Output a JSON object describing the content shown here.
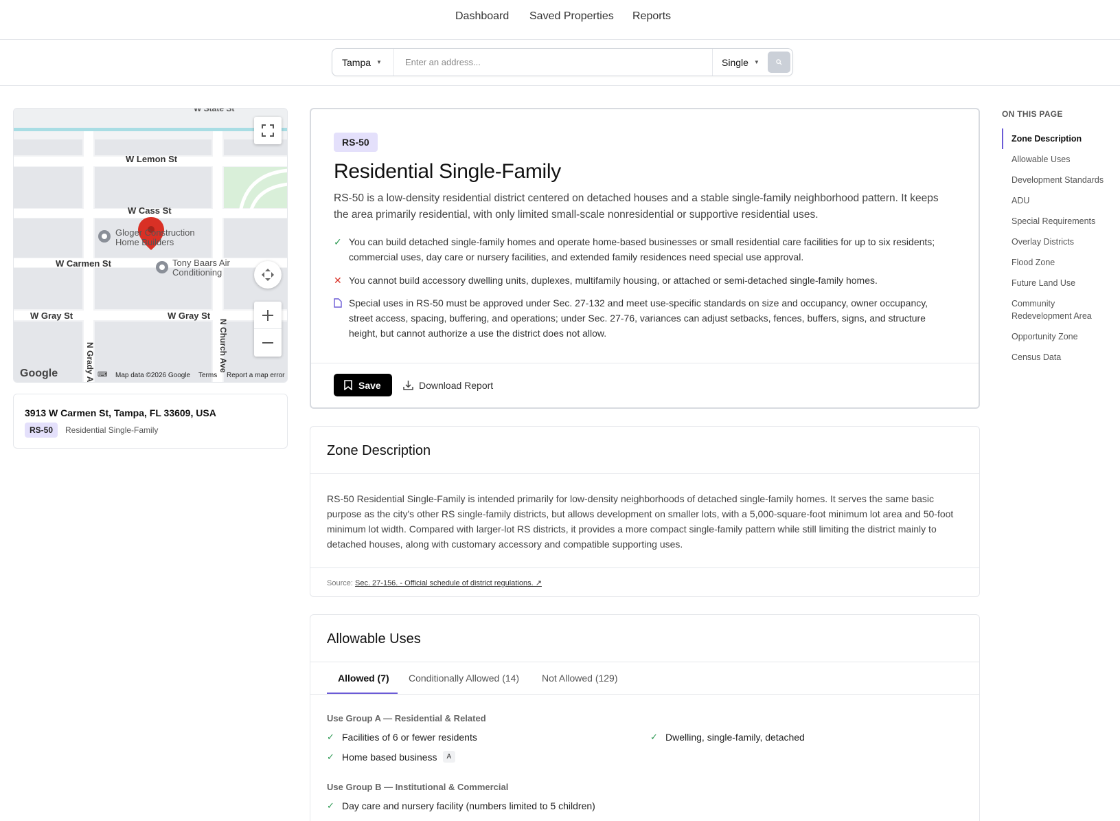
{
  "nav": {
    "links": [
      "Dashboard",
      "Saved Properties",
      "Reports"
    ]
  },
  "search": {
    "city": "Tampa",
    "address_placeholder": "Enter an address...",
    "type": "Single"
  },
  "map": {
    "streets": {
      "lemon": "W Lemon St",
      "cass": "W Cass St",
      "carmen": "W Carmen St",
      "gray_left": "W Gray St",
      "gray_right": "W Gray St",
      "grady": "N Grady A",
      "church": "N Church Ave",
      "state": "W State St"
    },
    "places": {
      "gloger_1": "Gloger Construction",
      "gloger_2": "Home Builders",
      "tony_1": "Tony Baars Air",
      "tony_2": "Conditioning"
    },
    "attribution": "Map data ©2026 Google",
    "terms": "Terms",
    "report": "Report a map error",
    "logo": "Google"
  },
  "property": {
    "address": "3913 W Carmen St, Tampa, FL 33609, USA",
    "zone_code": "RS-50",
    "zone_name": "Residential Single-Family"
  },
  "hero": {
    "zone_code": "RS-50",
    "title": "Residential Single-Family",
    "summary": "RS-50 is a low-density residential district centered on detached houses and a stable single-family neighborhood pattern. It keeps the area primarily residential, with only limited small-scale nonresidential or supportive residential uses.",
    "can": "You can build detached single-family homes and operate home-based businesses or small residential care facilities for up to six residents; commercial uses, day care or nursery facilities, and extended family residences need special use approval.",
    "cannot": "You cannot build accessory dwelling units, duplexes, multifamily housing, or attached or semi-detached single-family homes.",
    "special": "Special uses in RS-50 must be approved under Sec. 27-132 and meet use-specific standards on size and occupancy, owner occupancy, street access, spacing, buffering, and operations; under Sec. 27-76, variances can adjust setbacks, fences, buffers, signs, and structure height, but cannot authorize a use the district does not allow.",
    "save_label": "Save",
    "download_label": "Download Report"
  },
  "zone_description": {
    "heading": "Zone Description",
    "body": "RS-50 Residential Single-Family is intended primarily for low-density neighborhoods of detached single-family homes. It serves the same basic purpose as the city's other RS single-family districts, but allows development on smaller lots, with a 5,000-square-foot minimum lot area and 50-foot minimum lot width. Compared with larger-lot RS districts, it provides a more compact single-family pattern while still limiting the district mainly to detached houses, along with customary accessory and compatible supporting uses.",
    "source_prefix": "Source:",
    "source_link": "Sec. 27-156. - Official schedule of district regulations. ↗"
  },
  "allowable_uses": {
    "heading": "Allowable Uses",
    "tabs": [
      "Allowed (7)",
      "Conditionally Allowed (14)",
      "Not Allowed (129)"
    ],
    "group_a": {
      "title": "Use Group A — Residential & Related",
      "items": [
        "Facilities of 6 or fewer residents",
        "Dwelling, single-family, detached",
        "Home based business"
      ],
      "note": "A"
    },
    "group_b": {
      "title": "Use Group B — Institutional & Commercial",
      "items": [
        "Day care and nursery facility (numbers limited to 5 children)"
      ]
    }
  },
  "toc": {
    "title": "ON THIS PAGE",
    "items": [
      "Zone Description",
      "Allowable Uses",
      "Development Standards",
      "ADU",
      "Special Requirements",
      "Overlay Districts",
      "Flood Zone",
      "Future Land Use",
      "Community Redevelopment Area",
      "Opportunity Zone",
      "Census Data"
    ]
  },
  "colors": {
    "accent": "#6b5bd6",
    "badge_bg": "#e4e0fb",
    "check": "#2f9a55",
    "cross": "#d93025",
    "map_pin": "#d93025"
  }
}
